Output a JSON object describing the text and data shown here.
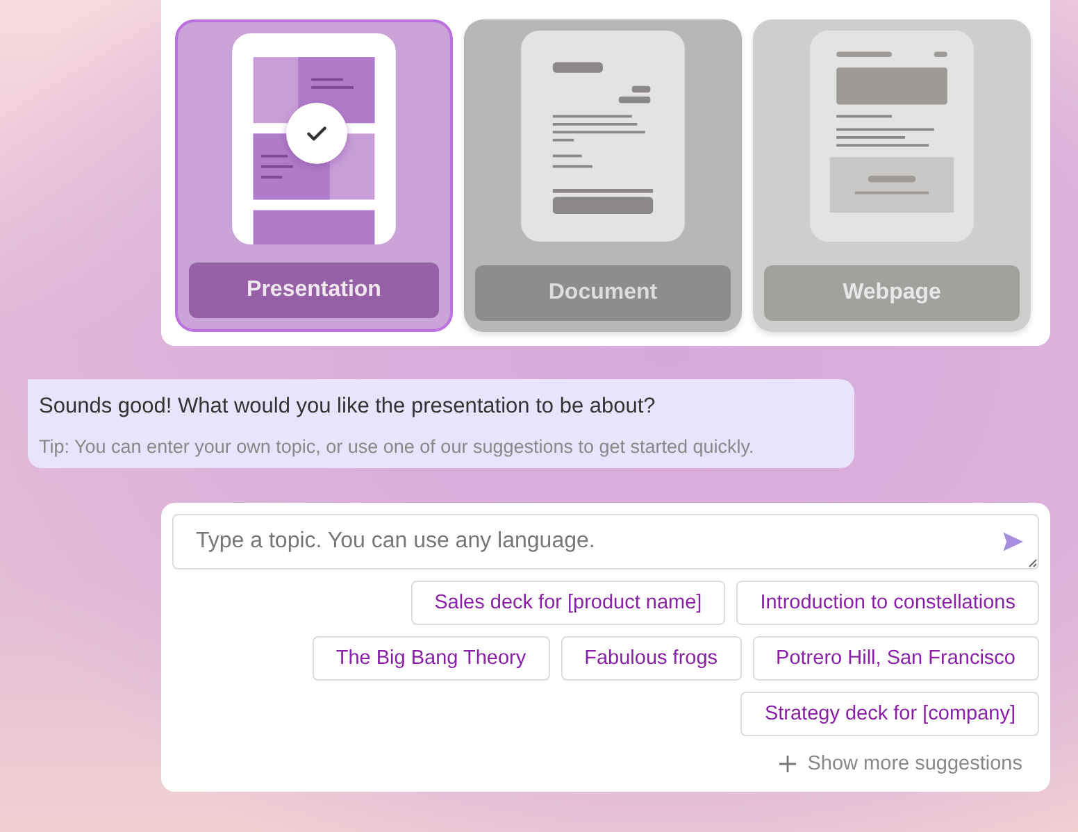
{
  "formats": [
    {
      "label": "Presentation",
      "kind": "presentation",
      "selected": true
    },
    {
      "label": "Document",
      "kind": "document",
      "selected": false
    },
    {
      "label": "Webpage",
      "kind": "webpage",
      "selected": false
    }
  ],
  "message": {
    "text": "Sounds good! What would you like the presentation to be about?",
    "tip": "Tip: You can enter your own topic, or use one of our suggestions to get started quickly."
  },
  "topic_input": {
    "placeholder": "Type a topic. You can use any language."
  },
  "suggestion_rows": [
    [
      "Sales deck for [product name]",
      "Introduction to constellations"
    ],
    [
      "The Big Bang Theory",
      "Fabulous frogs",
      "Potrero Hill, San Francisco"
    ],
    [
      "Strategy deck for [company]"
    ]
  ],
  "show_more": "Show more suggestions"
}
